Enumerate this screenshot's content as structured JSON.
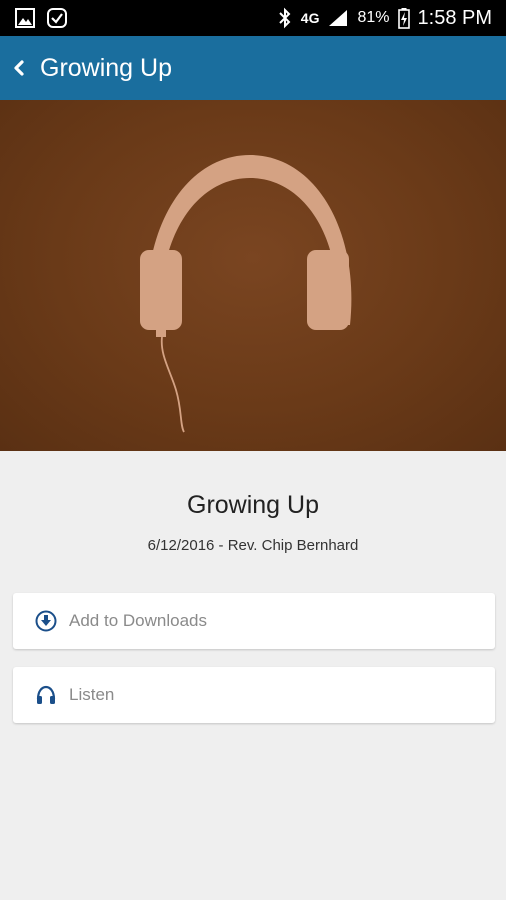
{
  "status_bar": {
    "battery_percent": "81%",
    "time": "1:58 PM",
    "network": "4G"
  },
  "app_bar": {
    "title": "Growing Up"
  },
  "sermon": {
    "title": "Growing Up",
    "subtitle": "6/12/2016 - Rev. Chip Bernhard"
  },
  "actions": {
    "download_label": "Add to Downloads",
    "listen_label": "Listen"
  },
  "colors": {
    "app_bar": "#1a6e9e",
    "hero_background": "#6a3a18",
    "headphones": "#d4a283",
    "icon_blue": "#1b4f8a"
  },
  "icons": {
    "back": "chevron-left-icon",
    "download": "download-circle-icon",
    "listen": "headphones-icon"
  }
}
